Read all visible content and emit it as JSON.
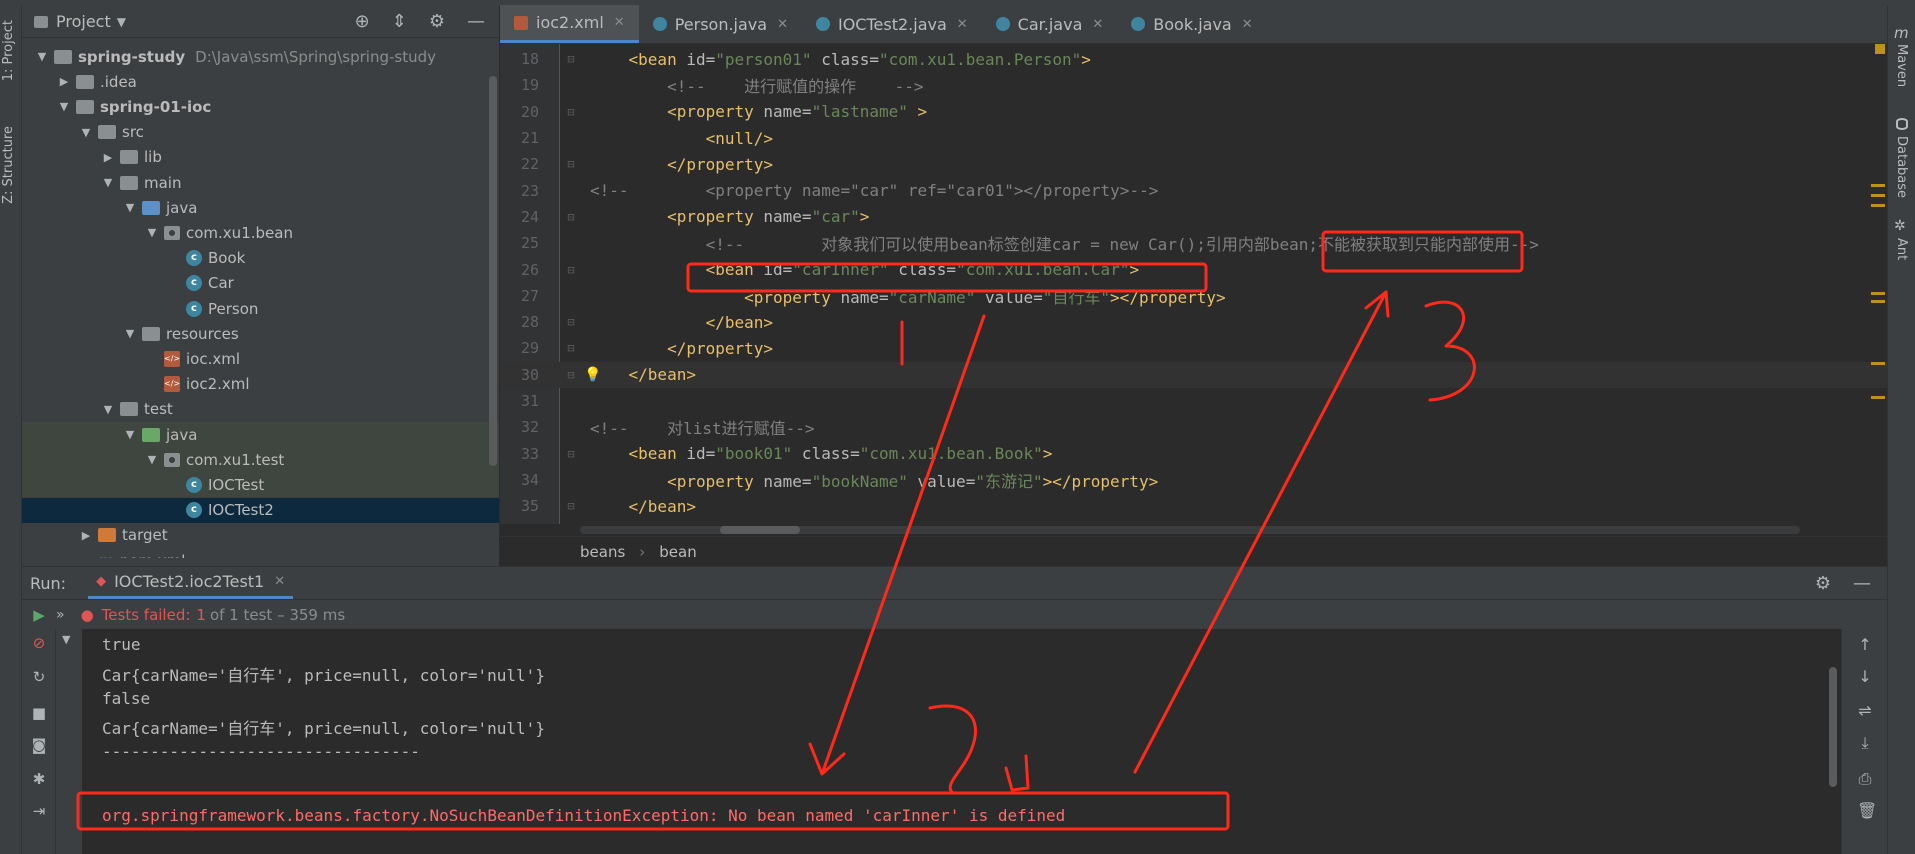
{
  "project_panel": {
    "title": "Project",
    "tree": [
      {
        "label": "spring-study",
        "path": "D:\\Java\\ssm\\Spring\\spring-study",
        "depth": 0,
        "kind": "module",
        "open": true
      },
      {
        "label": ".idea",
        "depth": 1,
        "kind": "folder",
        "open": false
      },
      {
        "label": "spring-01-ioc",
        "depth": 1,
        "kind": "module",
        "open": true
      },
      {
        "label": "src",
        "depth": 2,
        "kind": "folder",
        "open": true
      },
      {
        "label": "lib",
        "depth": 3,
        "kind": "folder",
        "open": false
      },
      {
        "label": "main",
        "depth": 3,
        "kind": "folder",
        "open": true
      },
      {
        "label": "java",
        "depth": 4,
        "kind": "folder-blue",
        "open": true
      },
      {
        "label": "com.xu1.bean",
        "depth": 5,
        "kind": "package",
        "open": true
      },
      {
        "label": "Book",
        "depth": 6,
        "kind": "class"
      },
      {
        "label": "Car",
        "depth": 6,
        "kind": "class"
      },
      {
        "label": "Person",
        "depth": 6,
        "kind": "class"
      },
      {
        "label": "resources",
        "depth": 4,
        "kind": "folder",
        "open": true
      },
      {
        "label": "ioc.xml",
        "depth": 5,
        "kind": "xml"
      },
      {
        "label": "ioc2.xml",
        "depth": 5,
        "kind": "xml"
      },
      {
        "label": "test",
        "depth": 3,
        "kind": "folder",
        "open": true
      },
      {
        "label": "java",
        "depth": 4,
        "kind": "folder-green",
        "open": true
      },
      {
        "label": "com.xu1.test",
        "depth": 5,
        "kind": "package",
        "open": true
      },
      {
        "label": "IOCTest",
        "depth": 6,
        "kind": "class"
      },
      {
        "label": "IOCTest2",
        "depth": 6,
        "kind": "class",
        "selected": true
      },
      {
        "label": "target",
        "depth": 2,
        "kind": "folder-orange",
        "open": false
      },
      {
        "label": "pom.xml",
        "depth": 2,
        "kind": "maven"
      }
    ]
  },
  "side_labels": {
    "project": "1: Project",
    "structure": "Z: Structure",
    "maven": "Maven",
    "database": "Database",
    "ant": "Ant"
  },
  "editor": {
    "tabs": [
      {
        "label": "ioc2.xml",
        "type": "xml",
        "active": true
      },
      {
        "label": "Person.java",
        "type": "class"
      },
      {
        "label": "IOCTest2.java",
        "type": "class"
      },
      {
        "label": "Car.java",
        "type": "class"
      },
      {
        "label": "Book.java",
        "type": "class"
      }
    ],
    "lines": [
      {
        "n": "18",
        "html_parts": [
          [
            "tag",
            "    <bean "
          ],
          [
            "attr",
            "id="
          ],
          [
            "val",
            "\"person01\""
          ],
          [
            "attr",
            " class="
          ],
          [
            "val",
            "\"com.xu1.bean.Person\""
          ],
          [
            "tag",
            ">"
          ]
        ]
      },
      {
        "n": "19",
        "html_parts": [
          [
            "cmt",
            "        <!--    进行赋值的操作    -->"
          ]
        ]
      },
      {
        "n": "20",
        "html_parts": [
          [
            "tag",
            "        <property "
          ],
          [
            "attr",
            "name="
          ],
          [
            "val",
            "\"lastname\""
          ],
          [
            "tag",
            " >"
          ]
        ]
      },
      {
        "n": "21",
        "html_parts": [
          [
            "tag",
            "            <null/>"
          ]
        ]
      },
      {
        "n": "22",
        "html_parts": [
          [
            "tag",
            "        </property>"
          ]
        ]
      },
      {
        "n": "23",
        "html_parts": [
          [
            "cmt",
            "<!--        <property name=\"car\" ref=\"car01\"></property>-->"
          ]
        ]
      },
      {
        "n": "24",
        "html_parts": [
          [
            "tag",
            "        <property "
          ],
          [
            "attr",
            "name="
          ],
          [
            "val",
            "\"car\""
          ],
          [
            "tag",
            ">"
          ]
        ]
      },
      {
        "n": "25",
        "html_parts": [
          [
            "cmt",
            "            <!--        对象我们可以使用bean标签创建car = new Car();引用内部bean;不能被获取到只能内部使用-->"
          ]
        ]
      },
      {
        "n": "26",
        "html_parts": [
          [
            "tag",
            "            <bean "
          ],
          [
            "attr",
            "id="
          ],
          [
            "val",
            "\"carInner\""
          ],
          [
            "attr",
            " class="
          ],
          [
            "val",
            "\"com.xu1.bean.Car\""
          ],
          [
            "tag",
            ">"
          ]
        ]
      },
      {
        "n": "27",
        "html_parts": [
          [
            "tag",
            "                <property "
          ],
          [
            "attr",
            "name="
          ],
          [
            "val",
            "\"carName\""
          ],
          [
            "attr",
            " value="
          ],
          [
            "val",
            "\"自行车\""
          ],
          [
            "tag",
            "></property>"
          ]
        ]
      },
      {
        "n": "28",
        "html_parts": [
          [
            "tag",
            "            </bean>"
          ]
        ]
      },
      {
        "n": "29",
        "html_parts": [
          [
            "tag",
            "        </property>"
          ]
        ]
      },
      {
        "n": "30",
        "html_parts": [
          [
            "tag",
            "    </bean>"
          ]
        ]
      },
      {
        "n": "31",
        "html_parts": [
          [
            "tag",
            ""
          ]
        ]
      },
      {
        "n": "32",
        "html_parts": [
          [
            "cmt",
            "<!--    对list进行赋值-->"
          ]
        ]
      },
      {
        "n": "33",
        "html_parts": [
          [
            "tag",
            "    <bean "
          ],
          [
            "attr",
            "id="
          ],
          [
            "val",
            "\"book01\""
          ],
          [
            "attr",
            " class="
          ],
          [
            "val",
            "\"com.xu1.bean.Book\""
          ],
          [
            "tag",
            ">"
          ]
        ]
      },
      {
        "n": "34",
        "html_parts": [
          [
            "tag",
            "        <property "
          ],
          [
            "attr",
            "name="
          ],
          [
            "val",
            "\"bookName\""
          ],
          [
            "attr",
            " value="
          ],
          [
            "val",
            "\"东游记\""
          ],
          [
            "tag",
            "></property>"
          ]
        ]
      },
      {
        "n": "35",
        "html_parts": [
          [
            "tag",
            "    </bean>"
          ]
        ]
      }
    ],
    "breadcrumbs": [
      "beans",
      "bean"
    ]
  },
  "run": {
    "label": "Run:",
    "config_tab": "IOCTest2.ioc2Test1",
    "status_prefix": "Tests failed:",
    "status_count": "1",
    "status_rest": "of 1 test – 359 ms",
    "console": [
      {
        "text": "true",
        "error": false
      },
      {
        "text": "Car{carName='自行车', price=null, color='null'}",
        "error": false
      },
      {
        "text": "false",
        "error": false
      },
      {
        "text": "Car{carName='自行车', price=null, color='null'}",
        "error": false
      },
      {
        "text": "---------------------------------",
        "error": false
      },
      {
        "text": "",
        "error": false
      },
      {
        "text": "org.springframework.beans.factory.NoSuchBeanDefinitionException: No bean named 'carInner' is defined",
        "error": true
      }
    ]
  },
  "colors": {
    "accent": "#4a88c7",
    "error": "#ff6b68",
    "annotation": "#ff2a1a"
  }
}
